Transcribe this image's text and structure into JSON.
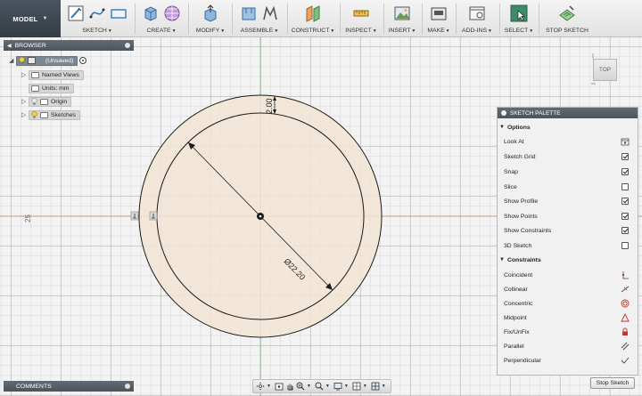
{
  "toolbar": {
    "workspace": "MODEL",
    "groups": [
      {
        "id": "sketch",
        "label": "SKETCH"
      },
      {
        "id": "create",
        "label": "CREATE"
      },
      {
        "id": "modify",
        "label": "MODIFY"
      },
      {
        "id": "assemble",
        "label": "ASSEMBLE"
      },
      {
        "id": "construct",
        "label": "CONSTRUCT"
      },
      {
        "id": "inspect",
        "label": "INSPECT"
      },
      {
        "id": "insert",
        "label": "INSERT"
      },
      {
        "id": "make",
        "label": "MAKE"
      },
      {
        "id": "addins",
        "label": "ADD-INS"
      },
      {
        "id": "select",
        "label": "SELECT"
      },
      {
        "id": "stop",
        "label": "STOP SKETCH"
      }
    ]
  },
  "browser": {
    "title": "BROWSER",
    "root": "(Unsaved)",
    "items": [
      "Named Views",
      "Units: mm",
      "Origin",
      "Sketches"
    ]
  },
  "viewcube": {
    "face": "TOP"
  },
  "canvas": {
    "diameter_dim": "Ø22.20",
    "offset_dim": "2.00",
    "axis_label": "25"
  },
  "palette": {
    "title": "SKETCH PALETTE",
    "options_title": "Options",
    "options": [
      {
        "label": "Look At",
        "type": "icon"
      },
      {
        "label": "Sketch Grid",
        "checked": true
      },
      {
        "label": "Snap",
        "checked": true
      },
      {
        "label": "Slice",
        "checked": false
      },
      {
        "label": "Show Profile",
        "checked": true
      },
      {
        "label": "Show Points",
        "checked": true
      },
      {
        "label": "Show Constraints",
        "checked": true
      },
      {
        "label": "3D Sketch",
        "checked": false
      }
    ],
    "constraints_title": "Constraints",
    "constraints": [
      {
        "label": "Coincident",
        "icon": "coincident-icon"
      },
      {
        "label": "Collinear",
        "icon": "collinear-icon"
      },
      {
        "label": "Concentric",
        "icon": "concentric-icon"
      },
      {
        "label": "Midpoint",
        "icon": "midpoint-icon"
      },
      {
        "label": "Fix/UnFix",
        "icon": "lock-icon"
      },
      {
        "label": "Parallel",
        "icon": "parallel-icon"
      },
      {
        "label": "Perpendicular",
        "icon": "perpendicular-icon"
      }
    ],
    "stop_button": "Stop Sketch"
  },
  "comments": {
    "title": "COMMENTS"
  },
  "colors": {
    "profile_fill": "#f2e4d4",
    "x_axis": "#c7826f",
    "y_axis": "#7fc17f",
    "accent_select": "#3f8a6a"
  }
}
